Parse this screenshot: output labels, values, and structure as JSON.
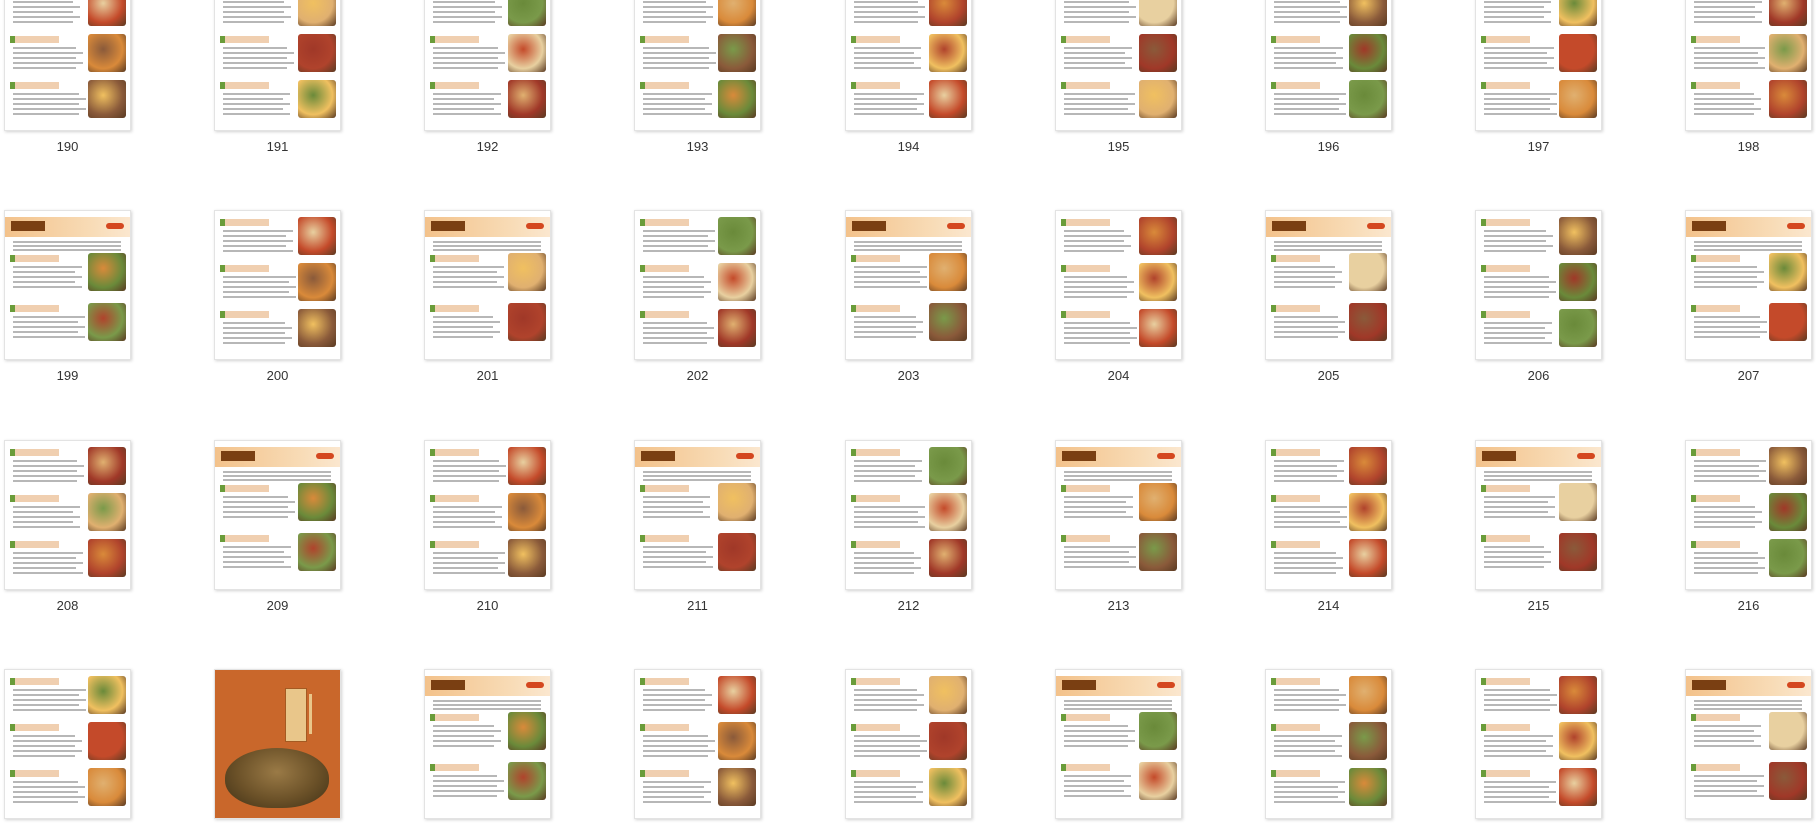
{
  "thumbnails": [
    {
      "page": "190",
      "style": "recipe"
    },
    {
      "page": "191",
      "style": "recipe"
    },
    {
      "page": "192",
      "style": "recipe"
    },
    {
      "page": "193",
      "style": "recipe"
    },
    {
      "page": "194",
      "style": "recipe"
    },
    {
      "page": "195",
      "style": "recipe"
    },
    {
      "page": "196",
      "style": "recipe"
    },
    {
      "page": "197",
      "style": "recipe"
    },
    {
      "page": "198",
      "style": "recipe"
    },
    {
      "page": "199",
      "style": "header"
    },
    {
      "page": "200",
      "style": "recipe"
    },
    {
      "page": "201",
      "style": "header"
    },
    {
      "page": "202",
      "style": "recipe"
    },
    {
      "page": "203",
      "style": "header"
    },
    {
      "page": "204",
      "style": "recipe"
    },
    {
      "page": "205",
      "style": "header"
    },
    {
      "page": "206",
      "style": "recipe"
    },
    {
      "page": "207",
      "style": "header"
    },
    {
      "page": "208",
      "style": "recipe"
    },
    {
      "page": "209",
      "style": "header"
    },
    {
      "page": "210",
      "style": "recipe"
    },
    {
      "page": "211",
      "style": "header"
    },
    {
      "page": "212",
      "style": "recipe"
    },
    {
      "page": "213",
      "style": "header"
    },
    {
      "page": "214",
      "style": "recipe"
    },
    {
      "page": "215",
      "style": "header"
    },
    {
      "page": "216",
      "style": "recipe"
    },
    {
      "page": "",
      "style": "recipe"
    },
    {
      "page": "",
      "style": "cover"
    },
    {
      "page": "",
      "style": "header"
    },
    {
      "page": "",
      "style": "recipe"
    },
    {
      "page": "",
      "style": "recipe"
    },
    {
      "page": "",
      "style": "header"
    },
    {
      "page": "",
      "style": "recipe"
    },
    {
      "page": "",
      "style": "recipe"
    },
    {
      "page": "",
      "style": "header"
    }
  ],
  "colors": {
    "accent_green": "#6a9c3a",
    "header_orange": "#f3c28b",
    "cover_orange": "#c9672b"
  },
  "food_colors": [
    "#c44a2a",
    "#e0b070",
    "#7a9a4a",
    "#d98a3a",
    "#b0432c",
    "#e8d0a0",
    "#8a5a3a",
    "#f0c060",
    "#a03828",
    "#6a8a3a"
  ]
}
